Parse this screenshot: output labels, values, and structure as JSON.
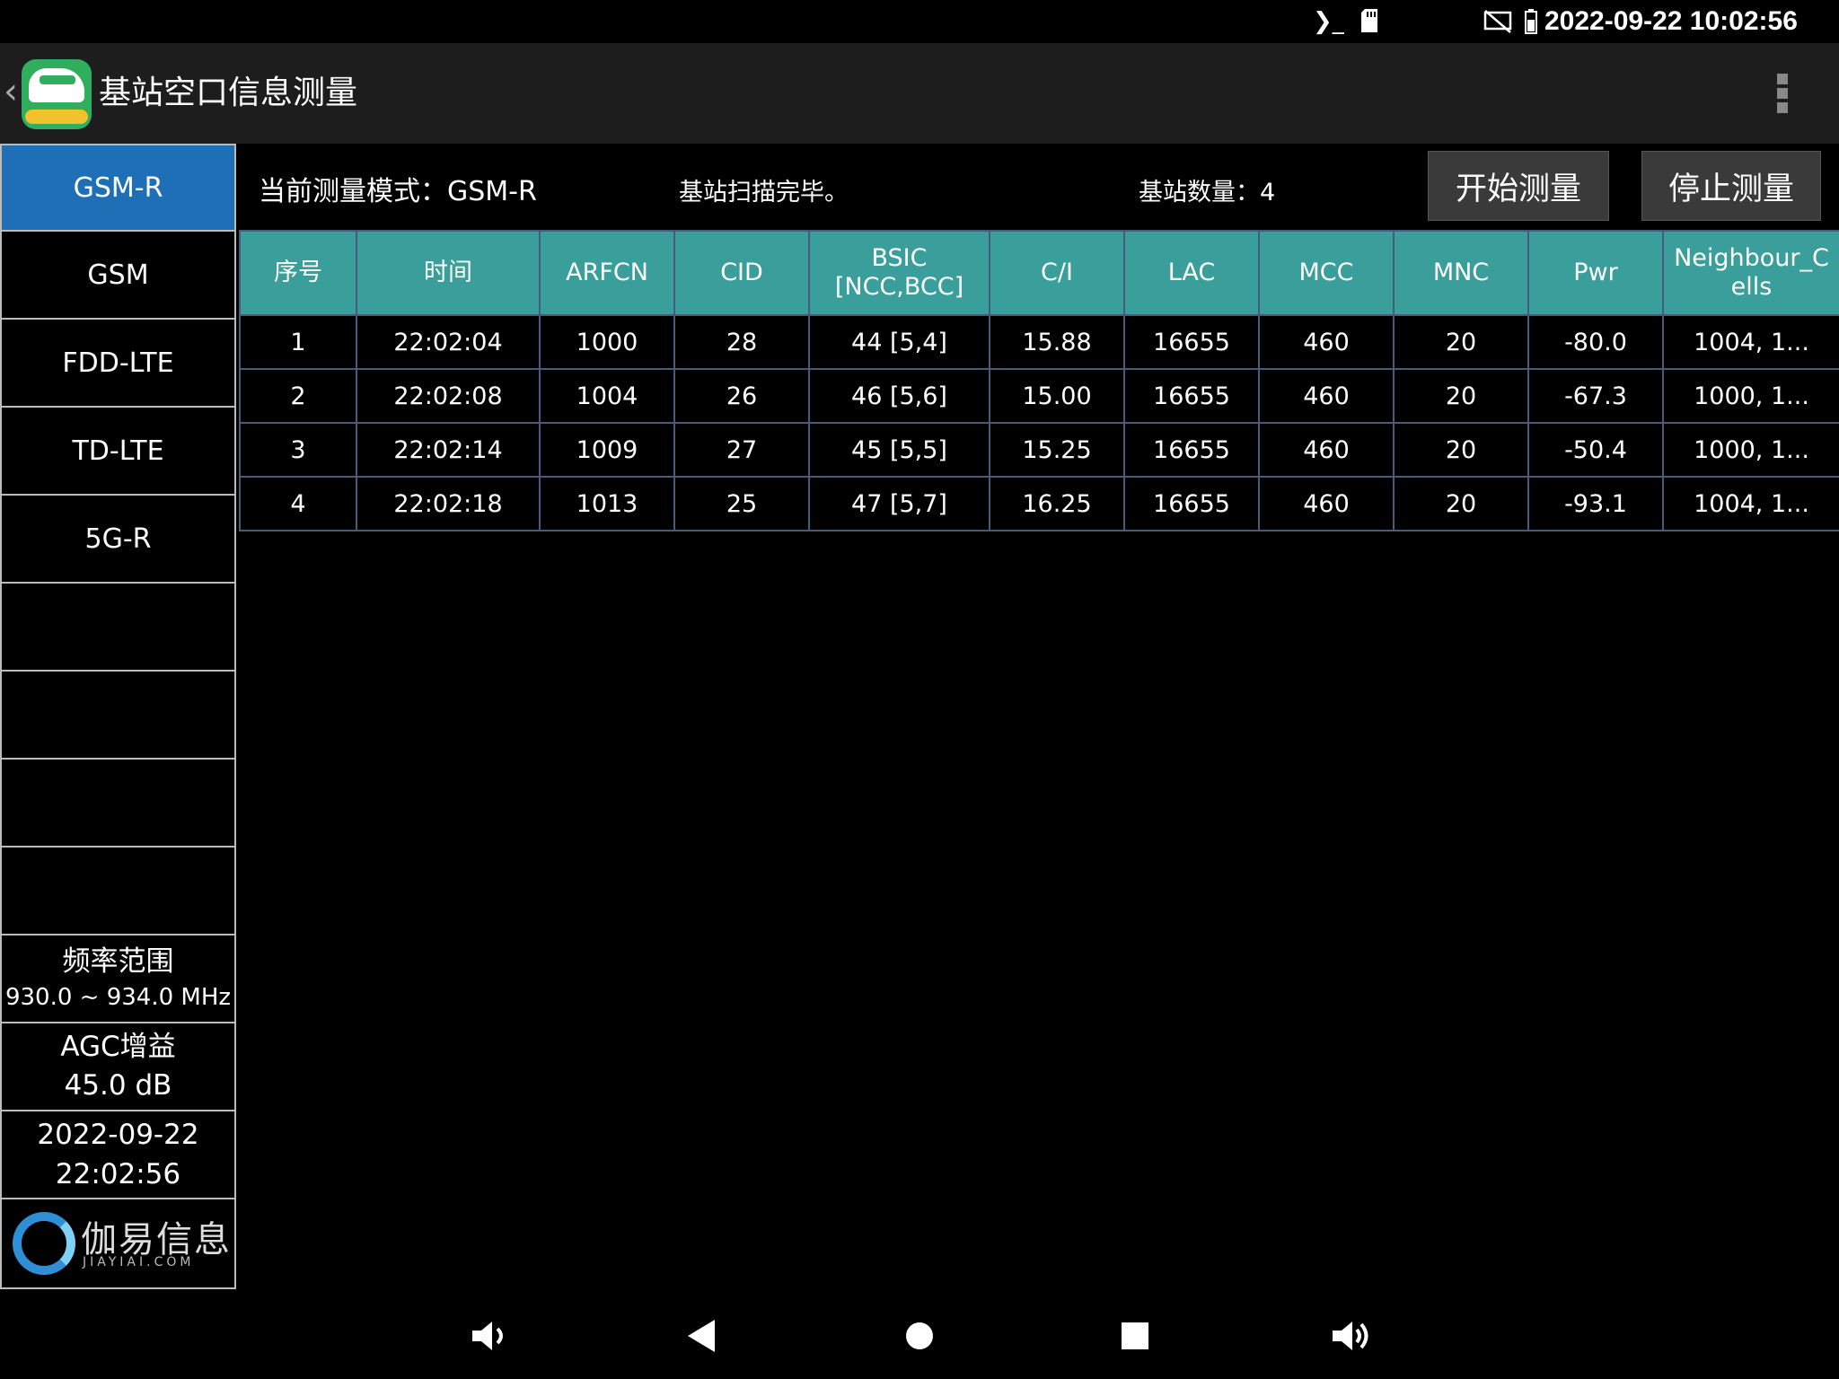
{
  "status_bar": {
    "terminal_icon": "terminal-icon",
    "sd_icon": "sd-card-icon",
    "cast_icon": "screen-cast-off-icon",
    "battery_icon": "battery-icon",
    "datetime": "2022-09-22 10:02:56"
  },
  "app_bar": {
    "title": "基站空口信息测量",
    "back_icon": "chevron-left-icon",
    "menu_icon": "more-vertical-icon"
  },
  "sidebar": {
    "items": [
      {
        "label": "GSM-R",
        "active": true
      },
      {
        "label": "GSM",
        "active": false
      },
      {
        "label": "FDD-LTE",
        "active": false
      },
      {
        "label": "TD-LTE",
        "active": false
      },
      {
        "label": "5G-R",
        "active": false
      },
      {
        "label": "",
        "active": false
      },
      {
        "label": "",
        "active": false
      },
      {
        "label": "",
        "active": false
      },
      {
        "label": "",
        "active": false
      }
    ],
    "freq_title": "频率范围",
    "freq_value": "930.0 ~ 934.0 MHz",
    "agc_title": "AGC增益",
    "agc_value": "45.0 dB",
    "date": "2022-09-22",
    "time": "22:02:56",
    "brand_name": "伽易信息",
    "brand_sub": "JIAYIAI.COM"
  },
  "controls": {
    "mode_text": "当前测量模式：GSM-R",
    "scan_status": "基站扫描完毕。",
    "count_text": "基站数量：4",
    "start_label": "开始测量",
    "stop_label": "停止测量"
  },
  "table": {
    "headers": [
      "序号",
      "时间",
      "ARFCN",
      "CID",
      "BSIC\n[NCC,BCC]",
      "C/I",
      "LAC",
      "MCC",
      "MNC",
      "Pwr",
      "Neighbour_Cells"
    ],
    "rows": [
      [
        "1",
        "22:02:04",
        "1000",
        "28",
        "44 [5,4]",
        "15.88",
        "16655",
        "460",
        "20",
        "-80.0",
        "1004, 1..."
      ],
      [
        "2",
        "22:02:08",
        "1004",
        "26",
        "46 [5,6]",
        "15.00",
        "16655",
        "460",
        "20",
        "-67.3",
        "1000, 1..."
      ],
      [
        "3",
        "22:02:14",
        "1009",
        "27",
        "45 [5,5]",
        "15.25",
        "16655",
        "460",
        "20",
        "-50.4",
        "1000, 1..."
      ],
      [
        "4",
        "22:02:18",
        "1013",
        "25",
        "47 [5,7]",
        "16.25",
        "16655",
        "460",
        "20",
        "-93.1",
        "1004, 1..."
      ]
    ]
  },
  "nav_bar": {
    "icons": [
      "volume-down-icon",
      "back-triangle-icon",
      "home-circle-icon",
      "recents-square-icon",
      "volume-up-icon"
    ]
  }
}
